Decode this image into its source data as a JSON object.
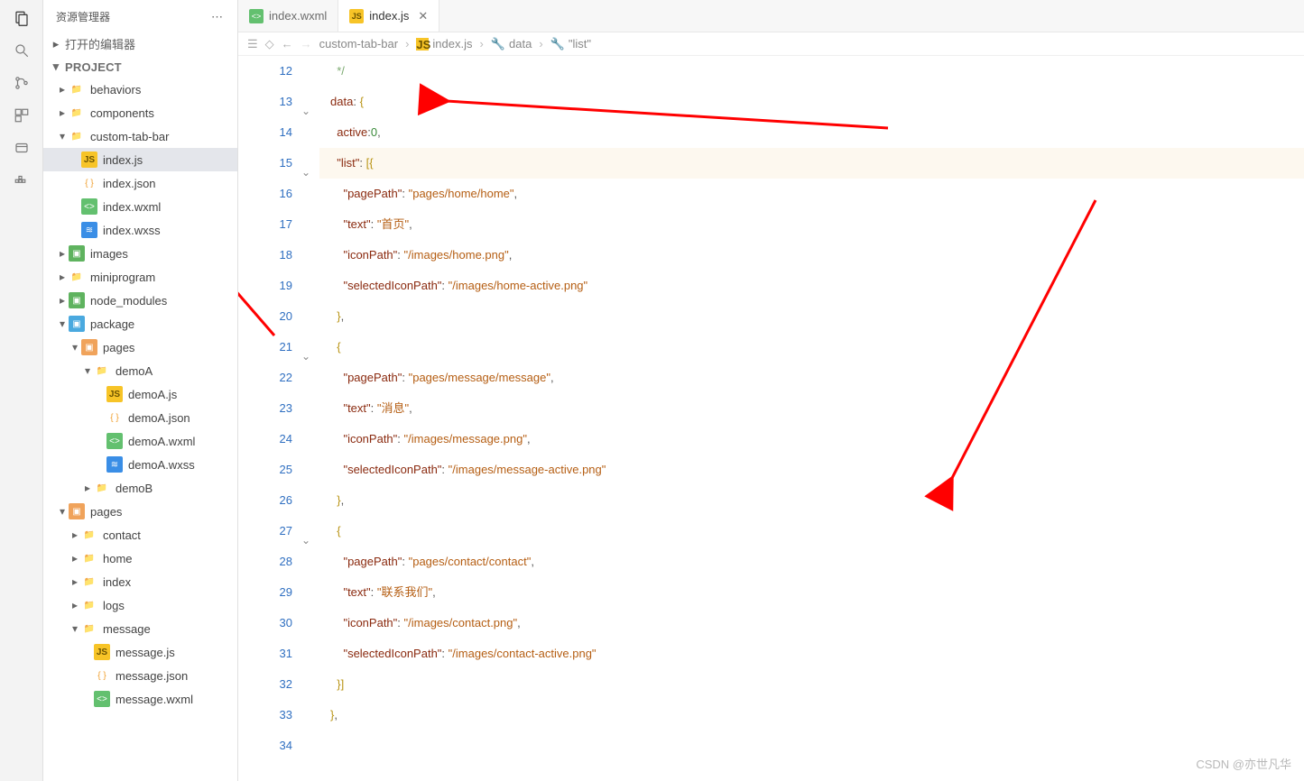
{
  "sidebar": {
    "title": "资源管理器",
    "sections": {
      "openEditors": "打开的编辑器",
      "project": "PROJECT"
    },
    "tree": [
      {
        "depth": 0,
        "arrow": "▸",
        "icon": "folder",
        "name": "behaviors"
      },
      {
        "depth": 0,
        "arrow": "▸",
        "icon": "folder",
        "name": "components"
      },
      {
        "depth": 0,
        "arrow": "▾",
        "icon": "folder",
        "name": "custom-tab-bar"
      },
      {
        "depth": 1,
        "arrow": "",
        "icon": "js",
        "name": "index.js",
        "selected": true
      },
      {
        "depth": 1,
        "arrow": "",
        "icon": "json",
        "name": "index.json"
      },
      {
        "depth": 1,
        "arrow": "",
        "icon": "wxml",
        "name": "index.wxml"
      },
      {
        "depth": 1,
        "arrow": "",
        "icon": "wxss",
        "name": "index.wxss"
      },
      {
        "depth": 0,
        "arrow": "▸",
        "icon": "folder-pkg",
        "name": "images"
      },
      {
        "depth": 0,
        "arrow": "▸",
        "icon": "folder",
        "name": "miniprogram"
      },
      {
        "depth": 0,
        "arrow": "▸",
        "icon": "folder-pkg",
        "name": "node_modules"
      },
      {
        "depth": 0,
        "arrow": "▾",
        "icon": "folder-blue",
        "name": "package"
      },
      {
        "depth": 1,
        "arrow": "▾",
        "icon": "folder-orange",
        "name": "pages"
      },
      {
        "depth": 2,
        "arrow": "▾",
        "icon": "folder",
        "name": "demoA"
      },
      {
        "depth": 3,
        "arrow": "",
        "icon": "js",
        "name": "demoA.js"
      },
      {
        "depth": 3,
        "arrow": "",
        "icon": "json",
        "name": "demoA.json"
      },
      {
        "depth": 3,
        "arrow": "",
        "icon": "wxml",
        "name": "demoA.wxml"
      },
      {
        "depth": 3,
        "arrow": "",
        "icon": "wxss",
        "name": "demoA.wxss"
      },
      {
        "depth": 2,
        "arrow": "▸",
        "icon": "folder",
        "name": "demoB"
      },
      {
        "depth": 0,
        "arrow": "▾",
        "icon": "folder-orange",
        "name": "pages"
      },
      {
        "depth": 1,
        "arrow": "▸",
        "icon": "folder",
        "name": "contact"
      },
      {
        "depth": 1,
        "arrow": "▸",
        "icon": "folder",
        "name": "home"
      },
      {
        "depth": 1,
        "arrow": "▸",
        "icon": "folder",
        "name": "index"
      },
      {
        "depth": 1,
        "arrow": "▸",
        "icon": "folder",
        "name": "logs"
      },
      {
        "depth": 1,
        "arrow": "▾",
        "icon": "folder",
        "name": "message"
      },
      {
        "depth": 2,
        "arrow": "",
        "icon": "js",
        "name": "message.js"
      },
      {
        "depth": 2,
        "arrow": "",
        "icon": "json",
        "name": "message.json"
      },
      {
        "depth": 2,
        "arrow": "",
        "icon": "wxml",
        "name": "message.wxml"
      }
    ]
  },
  "tabs": [
    {
      "icon": "wxml",
      "label": "index.wxml",
      "active": false,
      "close": false
    },
    {
      "icon": "js",
      "label": "index.js",
      "active": true,
      "close": true
    }
  ],
  "breadcrumb": {
    "parts": [
      "custom-tab-bar",
      "index.js",
      "data",
      "\"list\""
    ]
  },
  "code": {
    "start": 12,
    "lines": [
      {
        "n": 12,
        "html": "  <span class='tk-cmt'>*/</span>"
      },
      {
        "n": 13,
        "fold": true,
        "html": "<span class='tk-ident'>data</span><span class='tk-punct'>:</span> <span class='tk-brkt'>{</span>"
      },
      {
        "n": 14,
        "html": "  <span class='tk-ident'>active</span><span class='tk-punct'>:</span><span class='tk-num'>0</span><span class='tk-punct'>,</span>"
      },
      {
        "n": 15,
        "fold": true,
        "hl": true,
        "html": "  <span class='tk-key'>\"list\"</span><span class='tk-punct'>:</span> <span class='tk-brkt'>[</span><span class='tk-brkt'>{</span>"
      },
      {
        "n": 16,
        "html": "    <span class='tk-key'>\"pagePath\"</span><span class='tk-punct'>:</span> <span class='tk-str'>\"pages/home/home\"</span><span class='tk-punct'>,</span>"
      },
      {
        "n": 17,
        "html": "    <span class='tk-key'>\"text\"</span><span class='tk-punct'>:</span> <span class='tk-str'>\"首页\"</span><span class='tk-punct'>,</span>"
      },
      {
        "n": 18,
        "html": "    <span class='tk-key'>\"iconPath\"</span><span class='tk-punct'>:</span> <span class='tk-str'>\"/images/home.png\"</span><span class='tk-punct'>,</span>"
      },
      {
        "n": 19,
        "html": "    <span class='tk-key'>\"selectedIconPath\"</span><span class='tk-punct'>:</span> <span class='tk-str'>\"/images/home-active.png\"</span>"
      },
      {
        "n": 20,
        "html": "  <span class='tk-brkt'>}</span><span class='tk-punct'>,</span>"
      },
      {
        "n": 21,
        "fold": true,
        "html": "  <span class='tk-brkt'>{</span>"
      },
      {
        "n": 22,
        "html": "    <span class='tk-key'>\"pagePath\"</span><span class='tk-punct'>:</span> <span class='tk-str'>\"pages/message/message\"</span><span class='tk-punct'>,</span>"
      },
      {
        "n": 23,
        "html": "    <span class='tk-key'>\"text\"</span><span class='tk-punct'>:</span> <span class='tk-str'>\"消息\"</span><span class='tk-punct'>,</span>"
      },
      {
        "n": 24,
        "html": "    <span class='tk-key'>\"iconPath\"</span><span class='tk-punct'>:</span> <span class='tk-str'>\"/images/message.png\"</span><span class='tk-punct'>,</span>"
      },
      {
        "n": 25,
        "html": "    <span class='tk-key'>\"selectedIconPath\"</span><span class='tk-punct'>:</span> <span class='tk-str'>\"/images/message-active.png\"</span>"
      },
      {
        "n": 26,
        "html": "  <span class='tk-brkt'>}</span><span class='tk-punct'>,</span>"
      },
      {
        "n": 27,
        "fold": true,
        "html": "  <span class='tk-brkt'>{</span>"
      },
      {
        "n": 28,
        "html": "    <span class='tk-key'>\"pagePath\"</span><span class='tk-punct'>:</span> <span class='tk-str'>\"pages/contact/contact\"</span><span class='tk-punct'>,</span>"
      },
      {
        "n": 29,
        "html": "    <span class='tk-key'>\"text\"</span><span class='tk-punct'>:</span> <span class='tk-str'>\"联系我们\"</span><span class='tk-punct'>,</span>"
      },
      {
        "n": 30,
        "html": "    <span class='tk-key'>\"iconPath\"</span><span class='tk-punct'>:</span> <span class='tk-str'>\"/images/contact.png\"</span><span class='tk-punct'>,</span>"
      },
      {
        "n": 31,
        "html": "    <span class='tk-key'>\"selectedIconPath\"</span><span class='tk-punct'>:</span> <span class='tk-str'>\"/images/contact-active.png\"</span>"
      },
      {
        "n": 32,
        "html": "  <span class='tk-brkt'>}</span><span class='tk-brkt'>]</span>"
      },
      {
        "n": 33,
        "html": "<span class='tk-brkt'>}</span><span class='tk-punct'>,</span>"
      },
      {
        "n": 34,
        "html": ""
      }
    ]
  },
  "watermark": "CSDN @亦世凡华"
}
